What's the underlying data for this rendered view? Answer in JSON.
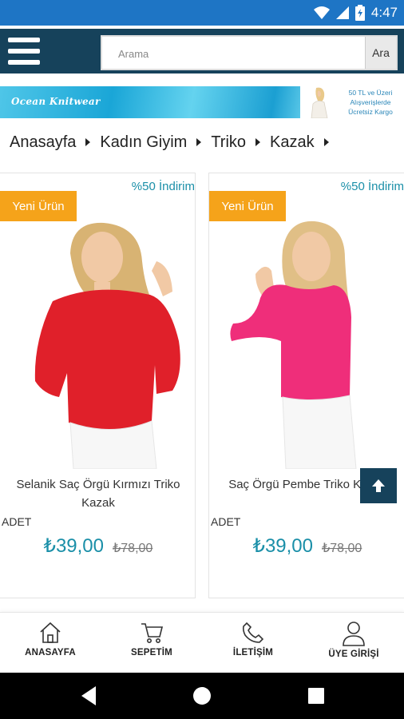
{
  "status_bar": {
    "time": "4:47"
  },
  "header": {
    "search_placeholder": "Arama",
    "search_button": "Ara"
  },
  "banner": {
    "brand": "Ocean Knitwear",
    "cargo_line1": "50 TL ve Üzeri",
    "cargo_line2": "Alışverişlerde",
    "cargo_line3": "Ücretsiz Kargo"
  },
  "breadcrumb": [
    "Anasayfa",
    "Kadın Giyim",
    "Triko",
    "Kazak"
  ],
  "products": [
    {
      "badge": "Yeni Ürün",
      "discount": "%50 İndirim",
      "name_line1": "Selanik Saç Örgü Kırmızı Triko",
      "name_line2": "Kazak",
      "unit": "ADET",
      "price": "₺39,00",
      "old_price": "₺78,00",
      "sweater_color": "#e0202a"
    },
    {
      "badge": "Yeni Ürün",
      "discount": "%50 İndirim",
      "name_line1": "Saç Örgü Pembe Triko Kazak",
      "name_line2": "",
      "unit": "ADET",
      "price": "₺39,00",
      "old_price": "₺78,00",
      "sweater_color": "#ef2e7a"
    }
  ],
  "bottom_nav": [
    {
      "label": "ANASAYFA",
      "icon": "home-icon"
    },
    {
      "label": "SEPETİM",
      "icon": "cart-icon"
    },
    {
      "label": "İLETİŞİM",
      "icon": "phone-icon"
    },
    {
      "label": "ÜYE GİRİŞİ",
      "icon": "user-icon"
    }
  ],
  "colors": {
    "status_bar": "#1e75c5",
    "header": "#16425b",
    "accent": "#1a8fa8",
    "badge": "#f5a31a"
  }
}
